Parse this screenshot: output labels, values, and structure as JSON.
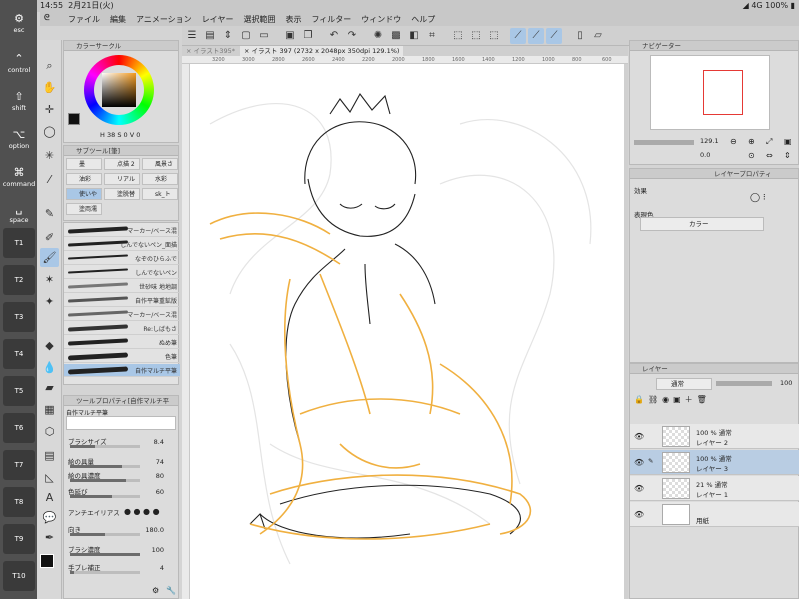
{
  "status": {
    "time": "14:55",
    "date": "2月21日(火)",
    "signal": "4G",
    "battery": "100%"
  },
  "menu": [
    "ファイル",
    "編集",
    "アニメーション",
    "レイヤー",
    "選択範囲",
    "表示",
    "フィルター",
    "ウィンドウ",
    "ヘルプ"
  ],
  "modifiers": [
    {
      "label": "esc",
      "icon": "gear-icon",
      "glyph": "⚙"
    },
    {
      "label": "control",
      "icon": "up-arrow-icon",
      "glyph": "⌃"
    },
    {
      "label": "shift",
      "icon": "shift-icon",
      "glyph": "⇧"
    },
    {
      "label": "option",
      "icon": "option-icon",
      "glyph": "⌥"
    },
    {
      "label": "command",
      "icon": "command-icon",
      "glyph": "⌘"
    },
    {
      "label": "space",
      "icon": "space-icon",
      "glyph": "␣"
    }
  ],
  "tkeys": [
    "T1",
    "T2",
    "T3",
    "T4",
    "T5",
    "T6",
    "T7",
    "T8",
    "T9",
    "T10"
  ],
  "color_panel": {
    "title": "カラーサークル",
    "readout_h": "38",
    "readout_s": "0",
    "readout_v": "0"
  },
  "subtool": {
    "title": "サブツール[筆]",
    "items": [
      "墨",
      "点描 2",
      "風景さ",
      "油彩",
      "リアル",
      "水彩",
      "使いや",
      "塗脱替",
      "sk_ト",
      "塗両濡"
    ]
  },
  "brushes": [
    "マーカー/ベース混",
    "しんでないペン_面描",
    "なぞのひらふで",
    "しんでないペン",
    "世砂味 地地調",
    "自作平筆重鉱版",
    "マーカー/ベース混",
    "Re:しばもさ",
    "ぬめ筆",
    "色筆",
    "自作マルチ平筆"
  ],
  "tool_property": {
    "title": "ツールプロパティ[自作マルチ平",
    "current_brush": "自作マルチ平筆",
    "rows": [
      {
        "label": "ブラシサイズ",
        "value": "8.4",
        "fill": 0.35
      },
      {
        "label": "絵の具量",
        "value": "74",
        "fill": 0.74
      },
      {
        "label": "絵の具濃度",
        "value": "80",
        "fill": 0.8
      },
      {
        "label": "色延び",
        "value": "60",
        "fill": 0.6
      },
      {
        "label": "アンチエイリアス",
        "value": "",
        "fill": 0
      },
      {
        "label": "向き",
        "value": "180.0",
        "fill": 0.5
      },
      {
        "label": "ブラシ濃度",
        "value": "100",
        "fill": 1.0
      },
      {
        "label": "手ブレ補正",
        "value": "4",
        "fill": 0.05
      }
    ]
  },
  "tabs": [
    {
      "label": "イラスト395*"
    },
    {
      "label": "イラスト 397 (2732 x 2048px 350dpi 129.1%)"
    }
  ],
  "ruler_marks": [
    "3200",
    "3000",
    "2800",
    "2600",
    "2400",
    "2200",
    "2000",
    "1800",
    "1600",
    "1400",
    "1200",
    "1000",
    "800",
    "600"
  ],
  "navigator": {
    "title": "ナビゲーター",
    "zoom": "129.1",
    "angle": "0.0"
  },
  "layer_property": {
    "tab": "レイヤープロパティ",
    "effect_label": "効果",
    "express_label": "表現色",
    "express_value": "カラー"
  },
  "layers_panel": {
    "title": "レイヤー",
    "blend_mode": "通常",
    "opacity": "100",
    "layers": [
      {
        "name": "レイヤー 2",
        "info": "100 % 通常",
        "selected": false
      },
      {
        "name": "レイヤー 3",
        "info": "100 % 通常",
        "selected": true
      },
      {
        "name": "レイヤー 1",
        "info": "21 % 通常",
        "selected": false
      },
      {
        "name": "用紙",
        "info": "",
        "selected": false
      }
    ]
  },
  "colors": {
    "accent": "#a9c7e6",
    "sketch_orange": "#f0b040"
  }
}
